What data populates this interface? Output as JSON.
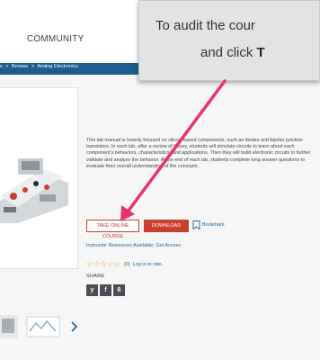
{
  "header": {
    "community_label": "COMMUNITY"
  },
  "breadcrumb": {
    "items": [
      "s",
      ">",
      "Browse",
      ">",
      "Analog Electronics"
    ]
  },
  "product": {
    "description": "This lab manual is heavily focused on silicon-based components, such as diodes and bipolar junction transistors. In each lab, after a review of theory, students will simulate circuits to learn about each component's behaviors, characteristics, and applications. Then they will build electronic circuits to further validate and analyze the behavior. At the end of each lab, students complete long answer questions to evaluate their overall understanding of the concepts.",
    "take_course_label": "TAKE ONLINE COURSE",
    "download_label": "DOWNLOAD",
    "bookmark_label": "Bookmark",
    "instructor_text": "Instructor Resources Available; Get Access",
    "rating_count": "(0)",
    "login_link": "Log in to rate.",
    "share_label": "SHARE",
    "social": [
      "y",
      "f",
      "8"
    ]
  },
  "tooltip": {
    "line1": "To audit the cour",
    "line2_prefix": "and click ",
    "line2_bold": "T"
  },
  "colors": {
    "accent_red": "#c8402f",
    "nav_blue": "#1e5d8c",
    "arrow_pink": "#e8336d"
  }
}
